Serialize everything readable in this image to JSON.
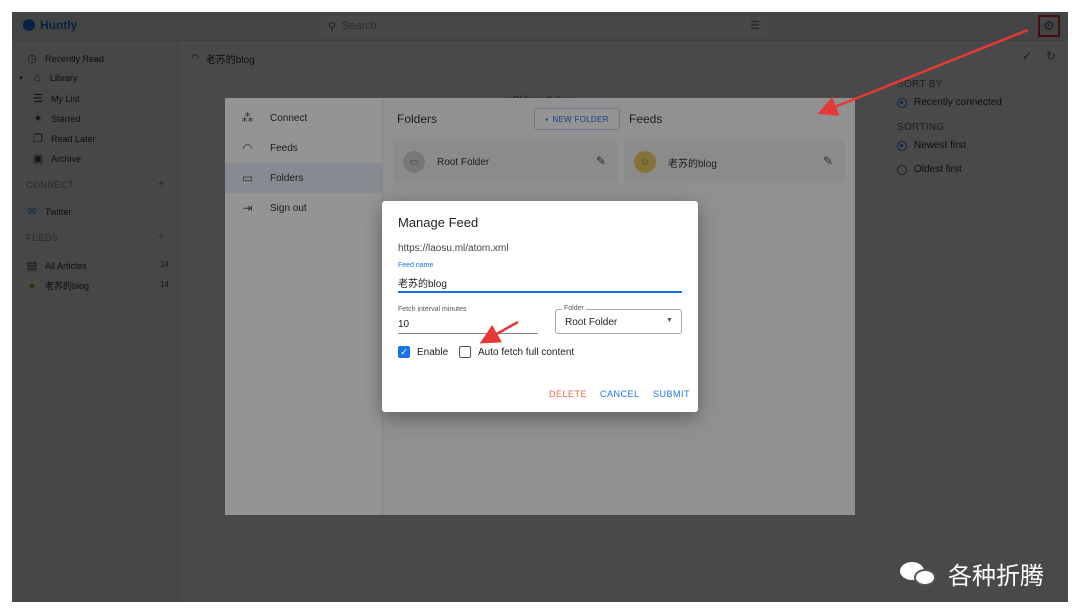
{
  "app": {
    "name": "Huntly"
  },
  "search": {
    "placeholder": "Search"
  },
  "sidebar": {
    "items": [
      {
        "label": "Recently Read",
        "icon": "clock-icon"
      },
      {
        "label": "Library",
        "icon": "library-icon"
      },
      {
        "label": "My List",
        "icon": "list-icon"
      },
      {
        "label": "Starred",
        "icon": "sparkle-icon"
      },
      {
        "label": "Read Later",
        "icon": "bookmark-icon"
      },
      {
        "label": "Archive",
        "icon": "archive-icon"
      }
    ],
    "connect_header": "CONNECT",
    "connect_items": [
      {
        "label": "Twitter",
        "icon": "twitter-icon"
      }
    ],
    "feeds_header": "FEEDS",
    "feed_items": [
      {
        "label": "All Articles",
        "count": "14"
      },
      {
        "label": "老苏的blog",
        "count": "14"
      }
    ]
  },
  "main": {
    "feed_title": "老苏的blog",
    "older_label": "Older articles"
  },
  "sort_panel": {
    "sort_by_header": "SORT BY",
    "sort_by_option": "Recently connected",
    "sorting_header": "SORTING",
    "sorting_options": [
      "Newest first",
      "Oldest first"
    ]
  },
  "settings": {
    "nav": [
      "Connect",
      "Feeds",
      "Folders",
      "Sign out"
    ],
    "folders_title": "Folders",
    "new_folder_label": "NEW FOLDER",
    "feeds_title": "Feeds",
    "folder_card": "Root Folder",
    "feed_card": "老苏的blog"
  },
  "dialog": {
    "title": "Manage Feed",
    "url": "https://laosu.ml/atom.xml",
    "feed_name_label": "Feed name",
    "feed_name_value": "老苏的blog",
    "fetch_label": "Fetch interval minutes",
    "fetch_value": "10",
    "folder_label": "Folder",
    "folder_value": "Root Folder",
    "enable_label": "Enable",
    "enable_checked": true,
    "auto_fetch_label": "Auto fetch full content",
    "auto_fetch_checked": false,
    "delete_label": "DELETE",
    "cancel_label": "CANCEL",
    "submit_label": "SUBMIT"
  },
  "watermark": {
    "text": "各种折腾"
  },
  "colors": {
    "accent": "#1a73e8",
    "danger": "#e8663d",
    "annotation": "#e53935"
  }
}
